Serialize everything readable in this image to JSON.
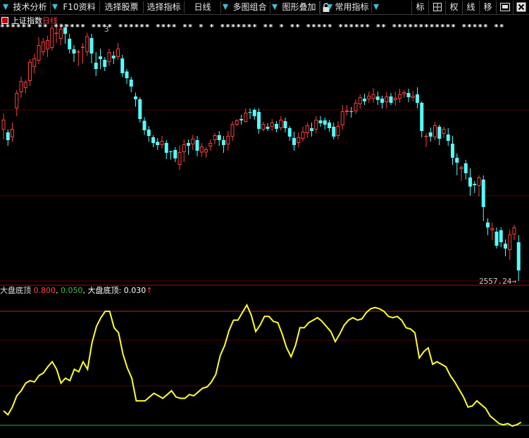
{
  "toolbar": {
    "items": [
      {
        "label": "技术分析",
        "dropdown": true
      },
      {
        "label": "F10资料",
        "dropdown": false
      },
      {
        "label": "选择股票",
        "dropdown": false
      },
      {
        "label": "选择指标",
        "dropdown": false
      },
      {
        "label": "日线",
        "dropdown": true
      },
      {
        "label": "多图组合",
        "dropdown": true
      },
      {
        "label": "图形叠加",
        "dropdown": false
      },
      {
        "label": "常用指标",
        "dropdown": true
      }
    ],
    "right_buttons": [
      "标",
      "⊞",
      "权",
      "线",
      "移"
    ],
    "lock_icon": "lock-icon",
    "window_icon": "window-icon",
    "close_icon": "close-icon"
  },
  "main_chart": {
    "title": "上证指数",
    "period": "日线",
    "stars": "****** ** ****** **** ****** **** ** * * ******* ** * ** ***** ****** ** ************ ***** **",
    "last_price_label": "2557.24",
    "top_price_label": "3",
    "colors": {
      "up": "#ff3c3c",
      "down": "#54fcfc",
      "grid": "#5a0000"
    }
  },
  "indicator": {
    "name": "大盘底顶",
    "params": [
      {
        "text": "0.800",
        "color": "#ff4040"
      },
      {
        "text": "0.050",
        "color": "#40c040"
      }
    ],
    "value_label": "大盘底顶:",
    "value": "0.030",
    "arrow": "↑",
    "line_color": "#ffff2c",
    "upper_line_color": "#c02020",
    "lower_line_color": "#20c020"
  },
  "chart_data": {
    "type": "line",
    "series": [
      {
        "values": [
          0.12,
          0.09,
          0.15,
          0.24,
          0.28,
          0.34,
          0.36,
          0.35,
          0.4,
          0.42,
          0.47,
          0.51,
          0.45,
          0.34,
          0.38,
          0.36,
          0.45,
          0.43,
          0.51,
          0.45,
          0.66,
          0.79,
          0.86,
          0.91,
          0.91,
          0.78,
          0.74,
          0.57,
          0.46,
          0.38,
          0.2,
          0.2,
          0.2,
          0.23,
          0.26,
          0.24,
          0.22,
          0.25,
          0.28,
          0.23,
          0.22,
          0.22,
          0.25,
          0.24,
          0.27,
          0.3,
          0.31,
          0.35,
          0.41,
          0.56,
          0.64,
          0.76,
          0.84,
          0.84,
          0.9,
          0.96,
          0.88,
          0.75,
          0.8,
          0.87,
          0.87,
          0.83,
          0.82,
          0.73,
          0.62,
          0.55,
          0.64,
          0.78,
          0.78,
          0.82,
          0.84,
          0.86,
          0.83,
          0.79,
          0.75,
          0.67,
          0.73,
          0.8,
          0.84,
          0.86,
          0.84,
          0.85,
          0.9,
          0.93,
          0.94,
          0.93,
          0.91,
          0.87,
          0.86,
          0.87,
          0.84,
          0.78,
          0.77,
          0.74,
          0.54,
          0.59,
          0.62,
          0.49,
          0.51,
          0.49,
          0.47,
          0.4,
          0.35,
          0.29,
          0.23,
          0.15,
          0.16,
          0.2,
          0.17,
          0.14,
          0.08,
          0.05,
          0.02,
          0.01,
          0.02,
          0.0,
          0.01,
          0.03
        ]
      }
    ],
    "candles": [
      [
        3090,
        3118,
        3072,
        3062,
        3135
      ],
      [
        3082,
        3060,
        3065,
        3044,
        3090
      ],
      [
        3068,
        3092,
        3077,
        3055,
        3110
      ],
      [
        3150,
        3194,
        3138,
        3128,
        3202
      ],
      [
        3196,
        3228,
        3200,
        3180,
        3240
      ],
      [
        3208,
        3225,
        3218,
        3192,
        3232
      ],
      [
        3228,
        3282,
        3218,
        3214,
        3290
      ],
      [
        3268,
        3292,
        3262,
        3250,
        3305
      ],
      [
        3286,
        3330,
        3280,
        3276,
        3352
      ],
      [
        3310,
        3340,
        3320,
        3300,
        3350
      ],
      [
        3318,
        3344,
        3307,
        3296,
        3356
      ],
      [
        3322,
        3379,
        3325,
        3315,
        3388
      ],
      [
        3362,
        3365,
        3350,
        3336,
        3392
      ],
      [
        3348,
        3376,
        3344,
        3330,
        3392
      ],
      [
        3380,
        3362,
        3370,
        3334,
        3390
      ],
      [
        3348,
        3318,
        3328,
        3306,
        3362
      ],
      [
        3318,
        3306,
        3290,
        3282,
        3330
      ],
      [
        3310,
        3312,
        3280,
        3270,
        3318
      ],
      [
        3324,
        3325,
        3283,
        3278,
        3335
      ],
      [
        3310,
        3355,
        3310,
        3299,
        3365
      ],
      [
        3350,
        3306,
        3336,
        3278,
        3362
      ],
      [
        3280,
        3262,
        3280,
        3242,
        3310
      ],
      [
        3298,
        3290,
        3276,
        3262,
        3320
      ],
      [
        3288,
        3268,
        3276,
        3256,
        3296
      ],
      [
        3282,
        3310,
        3290,
        3270,
        3320
      ],
      [
        3300,
        3292,
        3296,
        3276,
        3312
      ],
      [
        3296,
        3320,
        3304,
        3288,
        3336
      ],
      [
        3292,
        3250,
        3266,
        3240,
        3302
      ],
      [
        3255,
        3236,
        3244,
        3220,
        3262
      ],
      [
        3232,
        3212,
        3218,
        3196,
        3240
      ],
      [
        3184,
        3176,
        3175,
        3155,
        3195
      ],
      [
        3176,
        3120,
        3130,
        3110,
        3182
      ],
      [
        3115,
        3088,
        3100,
        3075,
        3125
      ],
      [
        3090,
        3072,
        3080,
        3055,
        3100
      ],
      [
        3068,
        3052,
        3056,
        3040,
        3074
      ],
      [
        3055,
        3046,
        3051,
        3032,
        3066
      ],
      [
        3046,
        3058,
        3054,
        3036,
        3072
      ],
      [
        3052,
        3024,
        3030,
        3006,
        3060
      ],
      [
        3028,
        3026,
        3023,
        3005,
        3030
      ],
      [
        3032,
        3008,
        3012,
        2998,
        3040
      ],
      [
        2990,
        3026,
        3005,
        2975,
        3045
      ],
      [
        3026,
        3048,
        3033,
        2998,
        3062
      ],
      [
        3052,
        3044,
        3046,
        3018,
        3062
      ],
      [
        3048,
        3064,
        3056,
        3032,
        3075
      ],
      [
        3060,
        3030,
        3038,
        3014,
        3072
      ],
      [
        3025,
        3042,
        3030,
        3012,
        3052
      ],
      [
        3025,
        3034,
        3030,
        3010,
        3040
      ],
      [
        3042,
        3052,
        3048,
        3030,
        3062
      ],
      [
        3060,
        3074,
        3066,
        3048,
        3080
      ],
      [
        3074,
        3060,
        3070,
        3044,
        3086
      ],
      [
        3060,
        3046,
        3054,
        3024,
        3072
      ],
      [
        3048,
        3072,
        3060,
        3030,
        3086
      ],
      [
        3070,
        3106,
        3094,
        3058,
        3114
      ],
      [
        3104,
        3116,
        3112,
        3100,
        3120
      ],
      [
        3120,
        3116,
        3118,
        3104,
        3132
      ],
      [
        3112,
        3138,
        3122,
        3110,
        3150
      ],
      [
        3140,
        3138,
        3136,
        3120,
        3150
      ],
      [
        3146,
        3128,
        3140,
        3118,
        3150
      ],
      [
        3140,
        3092,
        3108,
        3078,
        3150
      ],
      [
        3090,
        3106,
        3096,
        3084,
        3112
      ],
      [
        3098,
        3092,
        3096,
        3086,
        3108
      ],
      [
        3098,
        3110,
        3104,
        3086,
        3120
      ],
      [
        3106,
        3092,
        3094,
        3082,
        3114
      ],
      [
        3094,
        3118,
        3108,
        3088,
        3128
      ],
      [
        3114,
        3094,
        3100,
        3082,
        3124
      ],
      [
        3094,
        3070,
        3082,
        3058,
        3100
      ],
      [
        3066,
        3046,
        3054,
        3030,
        3084
      ],
      [
        3052,
        3068,
        3058,
        3040,
        3082
      ],
      [
        3064,
        3084,
        3072,
        3056,
        3098
      ],
      [
        3080,
        3102,
        3090,
        3066,
        3110
      ],
      [
        3094,
        3086,
        3094,
        3070,
        3110
      ],
      [
        3090,
        3118,
        3106,
        3080,
        3128
      ],
      [
        3116,
        3108,
        3114,
        3098,
        3128
      ],
      [
        3116,
        3104,
        3110,
        3090,
        3124
      ],
      [
        3110,
        3094,
        3102,
        3084,
        3118
      ],
      [
        3098,
        3070,
        3082,
        3062,
        3110
      ],
      [
        3072,
        3100,
        3088,
        3062,
        3114
      ],
      [
        3102,
        3142,
        3130,
        3090,
        3160
      ],
      [
        3140,
        3144,
        3142,
        3130,
        3160
      ],
      [
        3142,
        3140,
        3145,
        3124,
        3154
      ],
      [
        3142,
        3166,
        3152,
        3134,
        3176
      ],
      [
        3162,
        3182,
        3176,
        3150,
        3190
      ],
      [
        3178,
        3170,
        3174,
        3160,
        3192
      ],
      [
        3176,
        3186,
        3178,
        3166,
        3198
      ],
      [
        3178,
        3190,
        3188,
        3166,
        3208
      ],
      [
        3184,
        3174,
        3176,
        3160,
        3198
      ],
      [
        3178,
        3166,
        3170,
        3150,
        3186
      ],
      [
        3168,
        3184,
        3170,
        3150,
        3196
      ],
      [
        3184,
        3166,
        3176,
        3160,
        3194
      ],
      [
        3174,
        3180,
        3178,
        3158,
        3198
      ],
      [
        3178,
        3190,
        3184,
        3166,
        3206
      ],
      [
        3190,
        3196,
        3192,
        3180,
        3202
      ],
      [
        3194,
        3182,
        3188,
        3168,
        3206
      ],
      [
        3180,
        3186,
        3182,
        3170,
        3200
      ],
      [
        3190,
        3166,
        3178,
        3150,
        3210
      ],
      [
        3166,
        3086,
        3120,
        3068,
        3170
      ],
      [
        3070,
        3072,
        3070,
        3040,
        3080
      ],
      [
        3082,
        3070,
        3076,
        3056,
        3096
      ],
      [
        3068,
        3102,
        3094,
        3060,
        3112
      ],
      [
        3098,
        3064,
        3080,
        3046,
        3104
      ],
      [
        3078,
        3092,
        3084,
        3066,
        3098
      ],
      [
        3076,
        3058,
        3066,
        3044,
        3094
      ],
      [
        3050,
        3010,
        3030,
        2990,
        3072
      ],
      [
        3010,
        2996,
        3000,
        2960,
        3022
      ],
      [
        2978,
        2984,
        2980,
        2944,
        2988
      ],
      [
        2994,
        2966,
        2978,
        2948,
        3004
      ],
      [
        2954,
        2928,
        2944,
        2902,
        2980
      ],
      [
        2936,
        2932,
        2934,
        2910,
        2944
      ],
      [
        2930,
        2954,
        2942,
        2900,
        2960
      ],
      [
        2948,
        2870,
        2904,
        2830,
        2960
      ],
      [
        2826,
        2812,
        2816,
        2790,
        2838
      ],
      [
        2804,
        2810,
        2808,
        2776,
        2826
      ],
      [
        2800,
        2760,
        2780,
        2752,
        2812
      ],
      [
        2804,
        2770,
        2790,
        2756,
        2812
      ],
      [
        2766,
        2752,
        2758,
        2730,
        2778
      ],
      [
        2748,
        2792,
        2770,
        2720,
        2806
      ],
      [
        2792,
        2812,
        2800,
        2776,
        2820
      ],
      [
        2770,
        2690,
        2720,
        2660,
        2790
      ]
    ]
  }
}
